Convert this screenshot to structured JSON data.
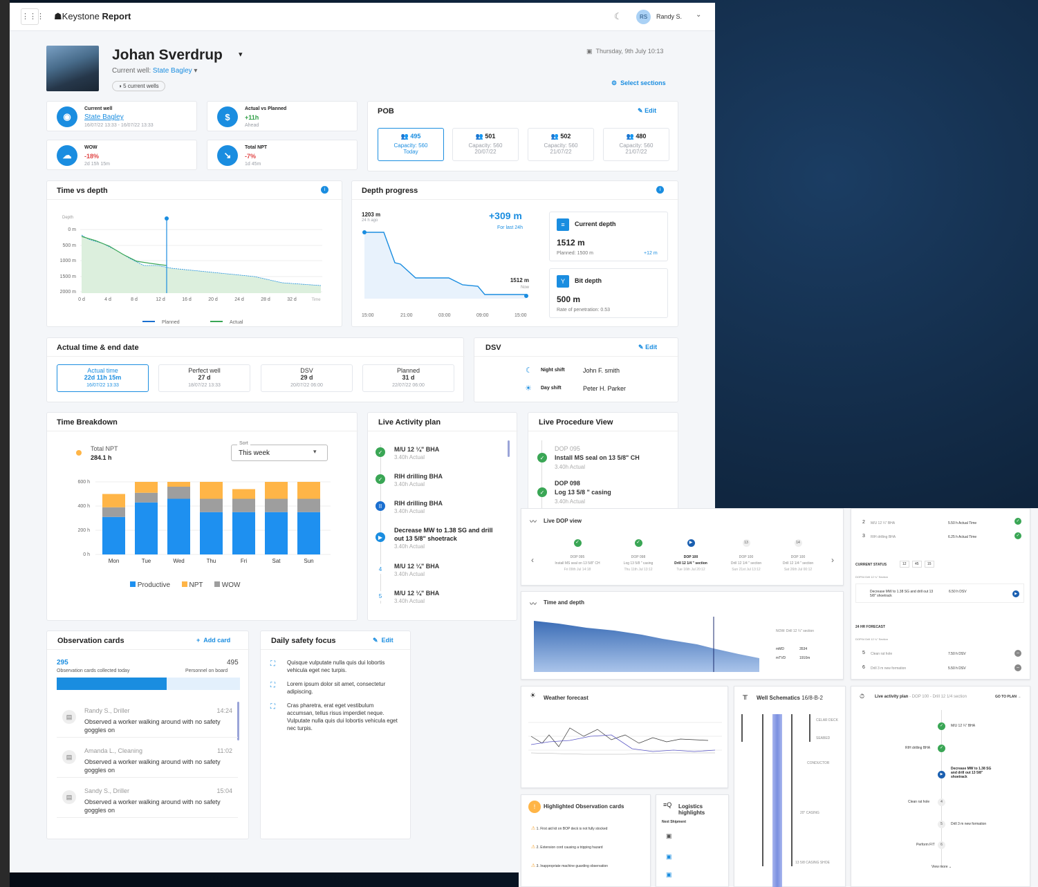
{
  "app": {
    "brand1": "Keystone",
    "brand2": "Report",
    "user_initials": "RS",
    "user_name": "Randy S."
  },
  "header": {
    "site": "Johan Sverdrup",
    "well_label": "Current well:",
    "well_name": "State Bagley",
    "wells_badge": "5 current wells",
    "datetime": "Thursday, 9th July 10:13",
    "select_sections": "Select sections"
  },
  "stats": [
    {
      "title": "Current well",
      "value": "State Bagley",
      "sub": "16/07/22 13:33 - 16/07/22 13:33"
    },
    {
      "title": "Actual vs Planned",
      "value": "+11h",
      "sub": "Ahead"
    },
    {
      "title": "WOW",
      "value": "-18%",
      "sub": "2d 15h 15m"
    },
    {
      "title": "Total NPT",
      "value": "-7%",
      "sub": "1d 45m"
    }
  ],
  "pob": {
    "title": "POB",
    "edit": "Edit",
    "items": [
      {
        "count": "495",
        "cap": "Capacity: 560",
        "date": "Today"
      },
      {
        "count": "501",
        "cap": "Capacity: 560",
        "date": "20/07/22"
      },
      {
        "count": "502",
        "cap": "Capacity: 560",
        "date": "21/07/22"
      },
      {
        "count": "480",
        "cap": "Capacity: 560",
        "date": "21/07/22"
      }
    ]
  },
  "tvd": {
    "title": "Time vs depth",
    "ylabel": "Depth",
    "xlabel": "Time",
    "yticks": [
      "0 m",
      "500 m",
      "1000 m",
      "1500 m",
      "2000 m"
    ],
    "xticks": [
      "0 d",
      "4 d",
      "8 d",
      "12 d",
      "16 d",
      "20 d",
      "24 d",
      "28 d",
      "32 d"
    ],
    "legend": [
      "Planned",
      "Actual"
    ]
  },
  "dp": {
    "title": "Depth progress",
    "start": "1203 m",
    "start_sub": "24 h ago",
    "delta": "+309 m",
    "delta_sub": "For last 24h",
    "end": "1512 m",
    "end_sub": "Now",
    "xticks": [
      "15:00",
      "21:00",
      "03:00",
      "09:00",
      "15:00"
    ],
    "current_label": "Current depth",
    "current_value": "1512 m",
    "current_planned": "Planned: 1500 m",
    "current_diff": "+12 m",
    "bit_label": "Bit depth",
    "bit_value": "500 m",
    "bit_sub": "Rate of penetration: 0.53"
  },
  "atd": {
    "title": "Actual time & end date",
    "items": [
      {
        "label": "Actual time",
        "value": "22d 11h 15m",
        "date": "16/07/22 13:33"
      },
      {
        "label": "Perfect well",
        "value": "27 d",
        "date": "18/07/22 13:33"
      },
      {
        "label": "DSV",
        "value": "29 d",
        "date": "20/07/22 06:00"
      },
      {
        "label": "Planned",
        "value": "31 d",
        "date": "22/07/22 06:00"
      }
    ]
  },
  "dsv": {
    "title": "DSV",
    "edit": "Edit",
    "night_label": "Night shift",
    "night_name": "John F. smith",
    "day_label": "Day shift",
    "day_name": "Peter H. Parker"
  },
  "tb": {
    "title": "Time Breakdown",
    "npt_label": "Total NPT",
    "npt_value": "284.1 h",
    "sort_label": "Sort",
    "sort_value": "This week",
    "yticks": [
      "600 h",
      "400 h",
      "200 h",
      "0 h"
    ],
    "legend": [
      "Productive",
      "NPT",
      "WOW"
    ]
  },
  "chart_data": {
    "type": "bar",
    "categories": [
      "Mon",
      "Tue",
      "Wed",
      "Thu",
      "Fri",
      "Sat",
      "Sun"
    ],
    "series": [
      {
        "name": "Productive",
        "values": [
          310,
          430,
          460,
          350,
          350,
          350,
          350
        ]
      },
      {
        "name": "WOW",
        "values": [
          80,
          80,
          100,
          110,
          110,
          110,
          110
        ]
      },
      {
        "name": "NPT",
        "values": [
          110,
          90,
          40,
          140,
          80,
          140,
          140
        ]
      }
    ],
    "ylim": [
      0,
      600
    ],
    "colors": [
      "#1e90f0",
      "#9e9e9e",
      "#ffb547"
    ]
  },
  "lap": {
    "title": "Live Activity plan",
    "items": [
      {
        "t": "M/U 12 ¼\" BHA",
        "s": "3.40h Actual"
      },
      {
        "t": "RIH drilling BHA",
        "s": "3.40h Actual"
      },
      {
        "t": "RIH drilling BHA",
        "s": "3.40h Actual"
      },
      {
        "t": "Decrease MW to 1.38 SG and drill out 13 5/8\" shoetrack",
        "s": "3.40h Actual"
      },
      {
        "t": "M/U 12 ¼\" BHA",
        "s": "3.40h Actual"
      },
      {
        "t": "M/U 12 ¼\" BHA",
        "s": "3.40h Actual"
      }
    ],
    "nums": [
      "4",
      "5"
    ]
  },
  "lpv": {
    "title": "Live Procedure View",
    "items": [
      {
        "code": "DOP 095",
        "t": "Install MS seal on 13 5/8\" CH",
        "s": "3.40h Actual"
      },
      {
        "code": "DOP 098",
        "t": "Log 13 5/8 \" casing",
        "s": "3.40h Actual"
      }
    ]
  },
  "obs": {
    "title": "Observation cards",
    "add": "Add card",
    "count": "295",
    "count_label": "Observation cards collected today",
    "personnel": "495",
    "personnel_label": "Personnel on board",
    "ratio": 0.6,
    "items": [
      {
        "n": "Randy S., Driller",
        "t": "14:24",
        "d": "Observed a worker walking around with no safety goggles on"
      },
      {
        "n": "Amanda L., Cleaning",
        "t": "11:02",
        "d": "Observed a worker walking around with no safety goggles on"
      },
      {
        "n": "Sandy S., Driller",
        "t": "15:04",
        "d": "Observed a worker walking around with no safety goggles on"
      }
    ]
  },
  "dsf": {
    "title": "Daily safety focus",
    "edit": "Edit",
    "items": [
      "Quisque vulputate nulla quis dui lobortis vehicula eget nec turpis.",
      "Lorem ipsum dolor sit amet, consectetur adipiscing.",
      "Cras pharetra, erat eget vestibulum accumsan, tellus risus imperdiet neque. Vulputate nulla quis dui lobortis vehicula eget nec turpis."
    ]
  },
  "second": {
    "dop_title": "Live DOP view",
    "dop_steps": [
      {
        "code": "DOP 095",
        "t": "Install MS seal on 13 5/8\" CH",
        "d": "Fri 09th Jul 14:18"
      },
      {
        "code": "DOP 098",
        "t": "Log 13 5/8 \" casing",
        "d": "Thu 11th Jul 13:12"
      },
      {
        "code": "DOP 100",
        "t": "Drill 12 1/4 \" section",
        "d": "Tue 16th Jul 20:12"
      },
      {
        "code": "DOP 100",
        "t": "Drill 12 1/4 \" section",
        "d": "Sun 21st Jul 13:12"
      },
      {
        "code": "DOP 100",
        "t": "Drill 12 1/4 \" section",
        "d": "Sat 26th Jul 00:12"
      }
    ],
    "dop_nums": [
      "13",
      "14"
    ],
    "td_title": "Time and depth",
    "td_now": "NOW: Drill 12 ¼\" section",
    "td_mmd_label": "mMD",
    "td_mmd": "3534",
    "td_mtvd_label": "mTVD",
    "td_mtvd": "1910m",
    "weather_title": "Weather forecast",
    "ws_title": "Well Schematics",
    "ws_id": "16/8-B-2",
    "ws_labels": [
      "CELAR DECK",
      "SEABED",
      "CONDUCTOR",
      "20\" CASING",
      "13 5/8 CASING SHOE"
    ],
    "hoc_title": "Highlighted Observation cards",
    "hoc_items": [
      "1. First aid kit on BOP deck is not fully stocked",
      "2. Extension cord causing a tripping hazard",
      "3. Inappropriate machine guarding observation"
    ],
    "log_title": "Logistics highlights",
    "log_sub": "Next Shipment",
    "rp_rows": [
      {
        "n": "2",
        "t": "M/U 12 ¼\" BHA",
        "v": "5.50 h Actual Time"
      },
      {
        "n": "3",
        "t": "RIH drilling BHA",
        "v": "6.25 h Actual Time"
      }
    ],
    "cs_label": "CURRENT STATUS",
    "cs_h": "12",
    "cs_m": "45",
    "cs_s": "15",
    "cs_sub": "DOP04 Drill 12 ¼\" Section",
    "cs_item": "Decrease MW to 1.38 SG and drill out 13 5/8\" shoetrack",
    "cs_val": "6.50 h DSV",
    "fc_label": "24 HR FORECAST",
    "fc_sub": "DOP04 Drill 12 ¼\" Section",
    "fc_rows": [
      {
        "n": "5",
        "t": "Clean rat hole",
        "v": "7.50 h DSV"
      },
      {
        "n": "6",
        "t": "Drill 3 m new formation",
        "v": "5.50 h DSV"
      }
    ],
    "lap2_title": "Live activity plan",
    "lap2_sub": "- DOP 100 - Drill 12 1/4 section",
    "goto": "GO TO PLAN",
    "lap2_items": [
      "M/U 12 ¼\" BHA",
      "RIH drilling BHA",
      "Decrease MW to 1.38 SG and drill out 13 5/8\" shoetrack",
      "Clean rat hole",
      "Drill 3 m new formation",
      "Perform FIT"
    ],
    "lap2_nums": [
      "4",
      "5",
      "6"
    ],
    "view_more": "View more"
  }
}
